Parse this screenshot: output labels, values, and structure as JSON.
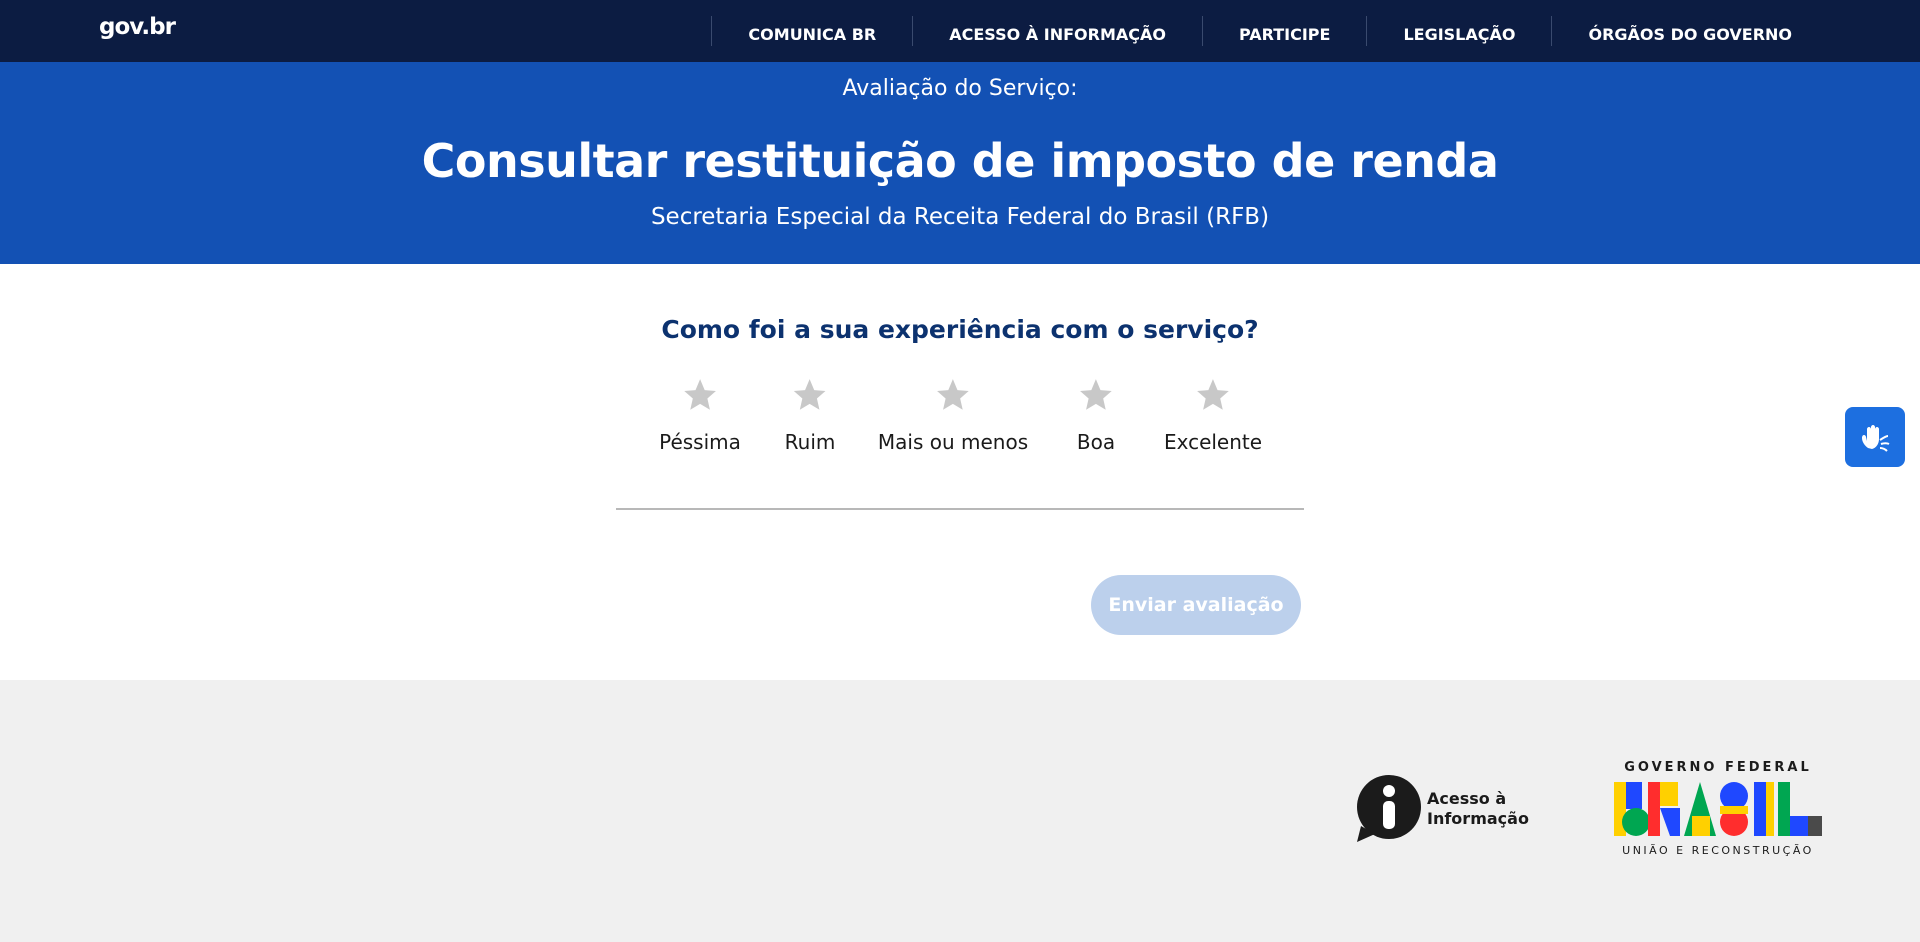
{
  "header": {
    "logo": "gov.br",
    "nav": [
      {
        "label": "COMUNICA BR"
      },
      {
        "label": "ACESSO À INFORMAÇÃO"
      },
      {
        "label": "PARTICIPE"
      },
      {
        "label": "LEGISLAÇÃO"
      },
      {
        "label": "ÓRGÃOS DO GOVERNO"
      }
    ]
  },
  "hero": {
    "kicker": "Avaliação do Serviço:",
    "title": "Consultar restituição de imposto de renda",
    "subtitle": "Secretaria Especial da Receita Federal do Brasil (RFB)"
  },
  "rating": {
    "question": "Como foi a sua experiência com o serviço?",
    "options": [
      {
        "label": "Péssima",
        "icon": "star-icon"
      },
      {
        "label": "Ruim",
        "icon": "star-icon"
      },
      {
        "label": "Mais ou menos",
        "icon": "star-icon"
      },
      {
        "label": "Boa",
        "icon": "star-icon"
      },
      {
        "label": "Excelente",
        "icon": "star-icon"
      }
    ],
    "selected": 0,
    "submit_label": "Enviar avaliação"
  },
  "footer": {
    "lai_line1": "Acesso à",
    "lai_line2": "Informação",
    "brand_top": "GOVERNO FEDERAL",
    "brand_word": "BRASIL",
    "brand_bottom": "UNIÃO E RECONSTRUÇÃO"
  },
  "colors": {
    "topbar": "#0c1c42",
    "hero": "#1351b4",
    "question": "#0c326f",
    "star": "#c8c8c8",
    "submit_disabled": "#bcd0ec",
    "vlibras": "#1d6fe0"
  },
  "widgets": {
    "vlibras_icon": "sign-language-hands-icon"
  }
}
